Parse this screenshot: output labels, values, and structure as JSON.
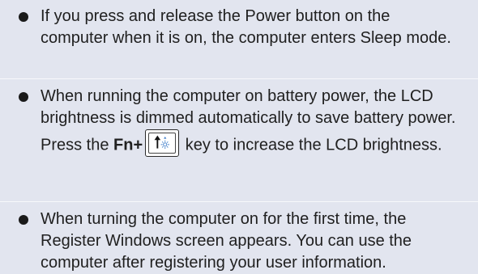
{
  "notes": [
    {
      "text": "If you press and release the Power button on the computer when it is on, the computer enters Sleep mode."
    },
    {
      "text": "When running the computer on battery power, the LCD brightness is dimmed automatically to save battery power.",
      "sub": {
        "prefix": "Press the ",
        "key_label": "Fn+",
        "key_icon": "brightness-up-key-icon",
        "suffix": " key to increase the LCD brightness."
      }
    },
    {
      "text": "When turning the computer on for the first time, the Register Windows screen appears. You can use the computer after registering your user information."
    }
  ],
  "colors": {
    "background": "#e2e5ef",
    "divider": "#f7f8fb",
    "text": "#202020",
    "bullet": "#1a1a1a"
  }
}
